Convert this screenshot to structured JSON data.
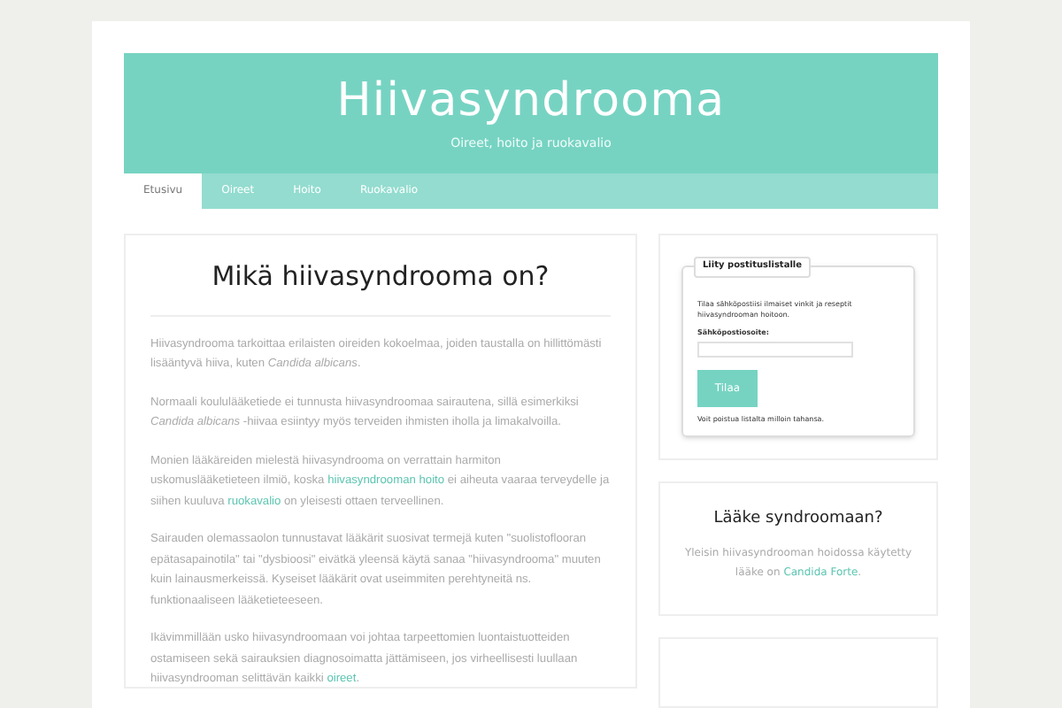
{
  "site": {
    "title": "Hiivasyndrooma",
    "tagline": "Oireet, hoito ja ruokavalio"
  },
  "nav": [
    {
      "label": "Etusivu",
      "selected": true
    },
    {
      "label": "Oireet",
      "selected": false
    },
    {
      "label": "Hoito",
      "selected": false
    },
    {
      "label": "Ruokavalio",
      "selected": false
    }
  ],
  "article": {
    "title": "Mikä hiivasyndrooma on?",
    "paragraphs": [
      [
        {
          "text": "Hiivasyndrooma tarkoittaa erilaisten oireiden kokoelmaa, joiden taustalla on hillittömästi lisääntyvä hiiva, kuten *Candida albicans*."
        }
      ],
      [
        {
          "text": "Normaali koululääketiede ei tunnusta hiivasyndroomaa sairautena, sillä esimerkiksi *Candida albicans* -hiivaa esiintyy myös terveiden ihmisten iholla ja limakalvoilla."
        }
      ],
      [
        {
          "text": "Monien lääkäreiden mielestä hiivasyndrooma on verrattain harmiton uskomuslääketieteen ilmiö, koska "
        },
        {
          "text": "hiivasyndrooman hoito",
          "link": true
        },
        {
          "text": " ei aiheuta vaaraa terveydelle ja siihen kuuluva "
        },
        {
          "text": "ruokavalio",
          "link": true
        },
        {
          "text": " on yleisesti ottaen terveellinen."
        }
      ],
      [
        {
          "text": "Sairauden olemassaolon tunnustavat lääkärit suosivat termejä kuten \"suolistoflooran epätasapainotila\" tai \"dysbioosi\" eivätkä yleensä käytä sanaa \"hiivasyndrooma\" muuten kuin lainausmerkeissä. Kyseiset lääkärit ovat useimmiten perehtyneitä ns. funktionaaliseen lääketieteeseen."
        }
      ],
      [
        {
          "text": "Ikävimmillään usko hiivasyndroomaan voi johtaa tarpeettomien luontaistuotteiden ostamiseen sekä sairauksien diagnosoimatta jättämiseen, jos virheellisesti luullaan hiivasyndrooman selittävän kaikki "
        },
        {
          "text": "oireet",
          "link": true
        },
        {
          "text": "."
        }
      ]
    ]
  },
  "newsletter": {
    "legend": "Liity postituslistalle",
    "intro": "Tilaa sähköpostiisi ilmaiset vinkit ja reseptit hiivasyndrooman hoitoon.",
    "field_label": "Sähköpostiosoite:",
    "button": "Tilaa",
    "note": "Voit poistua listalta milloin tahansa."
  },
  "medicine": {
    "title": "Lääke syndroomaan?",
    "text": [
      {
        "text": "Yleisin hiivasyndrooman hoidossa käytetty lääke on "
      },
      {
        "text": "Candida Forte",
        "link": true
      },
      {
        "text": "."
      }
    ]
  }
}
